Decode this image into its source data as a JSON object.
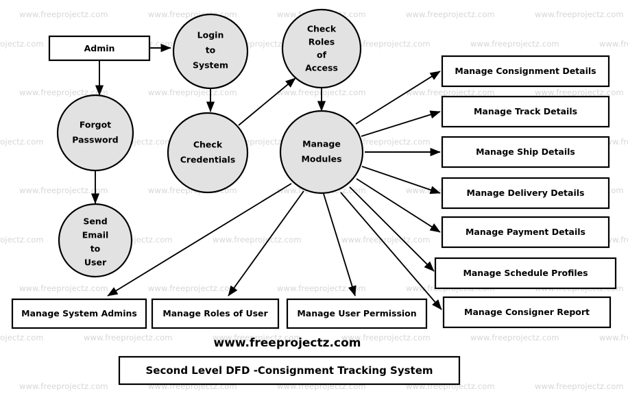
{
  "diagram": {
    "title": "Second Level DFD -Consignment Tracking System",
    "brand": "www.freeprojectz.com",
    "watermark_text": "www.freeprojectz.com",
    "colors": {
      "process_fill": "#e2e2e2",
      "entity_fill": "#ffffff",
      "stroke": "#000000",
      "watermark": "#d6d6d6",
      "background": "#ffffff"
    },
    "external_entities": [
      {
        "id": "admin",
        "label": "Admin"
      }
    ],
    "processes": [
      {
        "id": "login",
        "lines": [
          "Login",
          "to",
          "System"
        ]
      },
      {
        "id": "check_roles",
        "lines": [
          "Check",
          "Roles",
          "of",
          "Access"
        ]
      },
      {
        "id": "forgot_password",
        "lines": [
          "Forgot",
          "Password"
        ]
      },
      {
        "id": "check_credentials",
        "lines": [
          "Check",
          "Credentials"
        ]
      },
      {
        "id": "manage_modules",
        "lines": [
          "Manage",
          "Modules"
        ]
      },
      {
        "id": "send_email",
        "lines": [
          "Send",
          "Email",
          "to",
          "User"
        ]
      }
    ],
    "right_modules": [
      {
        "id": "consignment",
        "label": "Manage Consignment Details"
      },
      {
        "id": "track",
        "label": "Manage Track Details"
      },
      {
        "id": "ship",
        "label": "Manage Ship Details"
      },
      {
        "id": "delivery",
        "label": "Manage Delivery Details"
      },
      {
        "id": "payment",
        "label": "Manage Payment Details"
      },
      {
        "id": "schedule",
        "label": "Manage Schedule Profiles"
      },
      {
        "id": "consigner_report",
        "label": "Manage Consigner Report"
      }
    ],
    "bottom_modules": [
      {
        "id": "system_admins",
        "label": "Manage System Admins"
      },
      {
        "id": "roles_of_user",
        "label": "Manage Roles of User"
      },
      {
        "id": "user_permission",
        "label": "Manage User Permission"
      }
    ]
  }
}
